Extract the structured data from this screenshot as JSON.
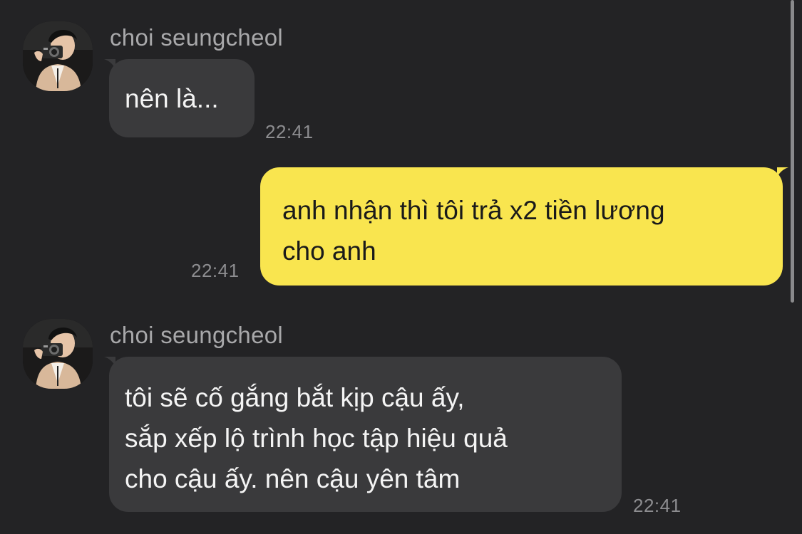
{
  "colors": {
    "background": "#232325",
    "incoming_bubble": "#3a3a3c",
    "outgoing_bubble": "#f9e54f",
    "sender_name": "#a8a8aa",
    "timestamp": "#8d8d90"
  },
  "messages": [
    {
      "direction": "incoming",
      "sender": "choi seungcheol",
      "avatar_icon": "profile-photo-camera-icon",
      "lines": [
        "nên là..."
      ],
      "time": "22:41"
    },
    {
      "direction": "outgoing",
      "lines": [
        "anh nhận thì tôi trả x2 tiền lương",
        "cho anh"
      ],
      "time": "22:41"
    },
    {
      "direction": "incoming",
      "sender": "choi seungcheol",
      "avatar_icon": "profile-photo-camera-icon",
      "lines": [
        "tôi sẽ cố gắng bắt kịp cậu ấy,",
        "sắp xếp lộ trình học tập hiệu quả",
        "cho cậu ấy. nên cậu yên tâm"
      ],
      "time": "22:41"
    }
  ]
}
